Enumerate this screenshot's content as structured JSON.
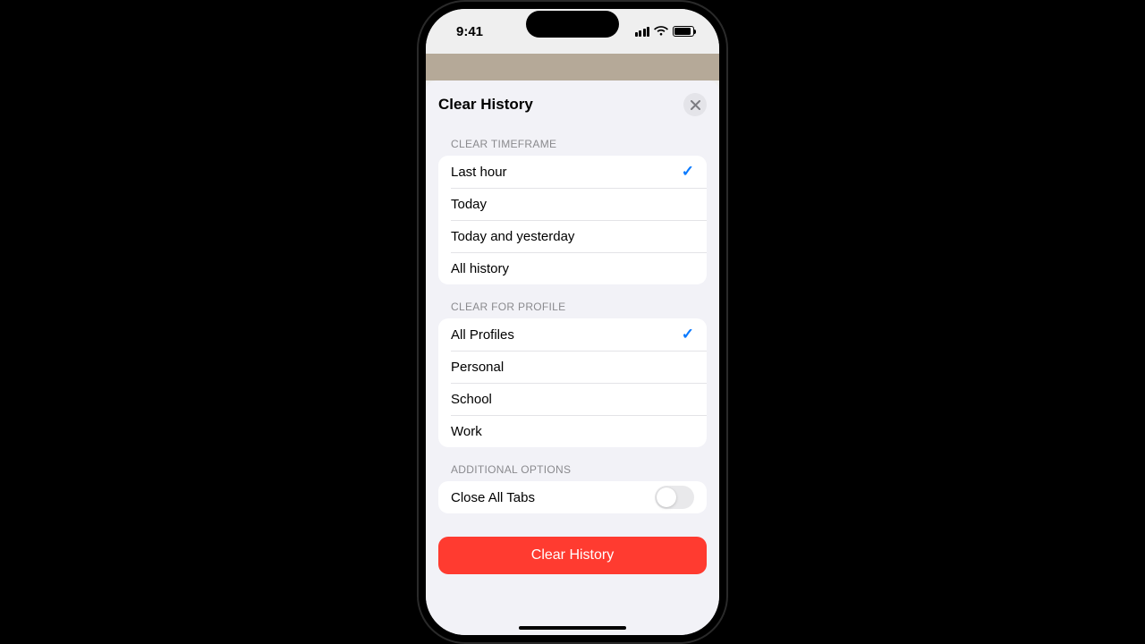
{
  "status": {
    "time": "9:41"
  },
  "sheet": {
    "title": "Clear History",
    "sections": {
      "timeframe": {
        "label": "CLEAR TIMEFRAME",
        "options": [
          "Last hour",
          "Today",
          "Today and yesterday",
          "All history"
        ],
        "selected_index": 0
      },
      "profile": {
        "label": "CLEAR FOR PROFILE",
        "options": [
          "All Profiles",
          "Personal",
          "School",
          "Work"
        ],
        "selected_index": 0
      },
      "additional": {
        "label": "ADDITIONAL OPTIONS",
        "close_tabs_label": "Close All Tabs",
        "close_tabs_on": false
      }
    },
    "primary_button": "Clear History"
  }
}
